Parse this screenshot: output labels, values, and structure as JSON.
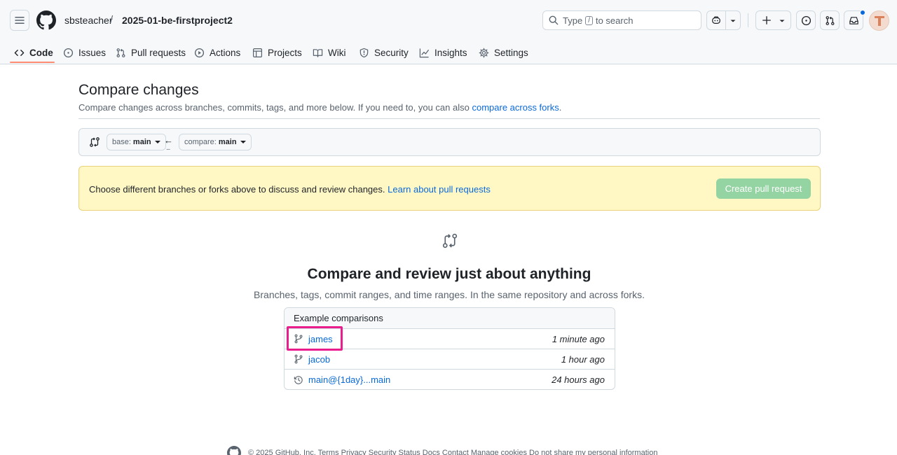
{
  "header": {
    "owner": "sbsteacher",
    "separator": "/",
    "repo": "2025-01-be-firstproject2",
    "search": {
      "pre": "Type",
      "kbd": "/",
      "post": "to search"
    }
  },
  "nav": {
    "items": [
      {
        "label": "Code",
        "icon": "code-icon",
        "selected": true
      },
      {
        "label": "Issues",
        "icon": "issue-opened-icon"
      },
      {
        "label": "Pull requests",
        "icon": "git-pull-request-icon"
      },
      {
        "label": "Actions",
        "icon": "play-icon"
      },
      {
        "label": "Projects",
        "icon": "table-icon"
      },
      {
        "label": "Wiki",
        "icon": "book-icon"
      },
      {
        "label": "Security",
        "icon": "shield-icon"
      },
      {
        "label": "Insights",
        "icon": "graph-icon"
      },
      {
        "label": "Settings",
        "icon": "gear-icon"
      }
    ]
  },
  "main": {
    "title": "Compare changes",
    "desc": "Compare changes across branches, commits, tags, and more below. If you need to, you can also ",
    "desc_link": "compare across forks",
    "desc_end": ".",
    "base": {
      "prefix": "base:",
      "branch": "main"
    },
    "compare": {
      "prefix": "compare:",
      "branch": "main"
    },
    "swap_arrow": "←",
    "swap_dots": "...",
    "flash": {
      "text": "Choose different branches or forks above to discuss and review changes. ",
      "link": "Learn about pull requests",
      "button": "Create pull request"
    },
    "blank": {
      "title": "Compare and review just about anything",
      "desc": "Branches, tags, commit ranges, and time ranges. In the same repository and across forks."
    },
    "examples": {
      "header": "Example comparisons",
      "rows": [
        {
          "label": "james",
          "time": "1 minute ago",
          "icon": "git-branch-icon"
        },
        {
          "label": "jacob",
          "time": "1 hour ago",
          "icon": "git-branch-icon"
        },
        {
          "label": "main@{1day}...main",
          "time": "24 hours ago",
          "icon": "history-icon"
        }
      ]
    }
  },
  "footer": {
    "text": "© 2025 GitHub, Inc.   Terms   Privacy   Security   Status   Docs   Contact   Manage cookies   Do not share my personal information"
  },
  "colors": {
    "accent": "#0969da",
    "nav_underline": "#fd8c73",
    "flash_bg": "#fff8c5",
    "button_disabled": "#94d3a2",
    "highlight": "#e91e8c"
  }
}
